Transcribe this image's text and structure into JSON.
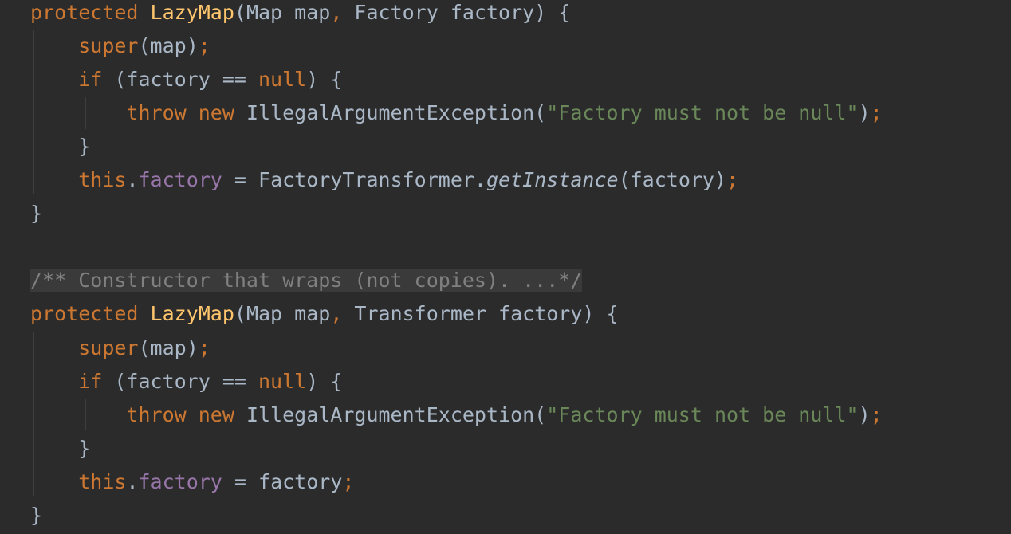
{
  "editor": {
    "theme": {
      "background": "#2b2b2b",
      "keyword": "#cc7832",
      "method": "#ffc66d",
      "identifier": "#a9b7c6",
      "string": "#6a8759",
      "field": "#9876aa",
      "comment": "#808080"
    },
    "lines": [
      [
        {
          "t": "protected",
          "c": "kw"
        },
        {
          "t": " ",
          "c": "id"
        },
        {
          "t": "LazyMap",
          "c": "fn"
        },
        {
          "t": "(Map map",
          "c": "id"
        },
        {
          "t": ",",
          "c": "kw"
        },
        {
          "t": " Factory factory) {",
          "c": "id"
        }
      ],
      [
        {
          "t": "    ",
          "c": "id"
        },
        {
          "t": "super",
          "c": "kw"
        },
        {
          "t": "(map)",
          "c": "id"
        },
        {
          "t": ";",
          "c": "kw"
        }
      ],
      [
        {
          "t": "    ",
          "c": "id"
        },
        {
          "t": "if",
          "c": "kw"
        },
        {
          "t": " (factory == ",
          "c": "id"
        },
        {
          "t": "null",
          "c": "kw"
        },
        {
          "t": ") {",
          "c": "id"
        }
      ],
      [
        {
          "t": "        ",
          "c": "id"
        },
        {
          "t": "throw new",
          "c": "kw"
        },
        {
          "t": " IllegalArgumentException(",
          "c": "id"
        },
        {
          "t": "\"Factory must not be null\"",
          "c": "str"
        },
        {
          "t": ")",
          "c": "id"
        },
        {
          "t": ";",
          "c": "kw"
        }
      ],
      [
        {
          "t": "    }",
          "c": "id"
        }
      ],
      [
        {
          "t": "    ",
          "c": "id"
        },
        {
          "t": "this",
          "c": "kw"
        },
        {
          "t": ".",
          "c": "id"
        },
        {
          "t": "factory",
          "c": "fld"
        },
        {
          "t": " = FactoryTransformer.",
          "c": "id"
        },
        {
          "t": "getInstance",
          "c": "id it"
        },
        {
          "t": "(factory)",
          "c": "id"
        },
        {
          "t": ";",
          "c": "kw"
        }
      ],
      [
        {
          "t": "}",
          "c": "id"
        }
      ],
      [],
      [
        {
          "t": "/** Constructor that wraps (not copies). ...*/",
          "c": "cm"
        }
      ],
      [
        {
          "t": "protected",
          "c": "kw"
        },
        {
          "t": " ",
          "c": "id"
        },
        {
          "t": "LazyMap",
          "c": "fn"
        },
        {
          "t": "(Map map",
          "c": "id"
        },
        {
          "t": ",",
          "c": "kw"
        },
        {
          "t": " Transformer factory) {",
          "c": "id"
        }
      ],
      [
        {
          "t": "    ",
          "c": "id"
        },
        {
          "t": "super",
          "c": "kw"
        },
        {
          "t": "(map)",
          "c": "id"
        },
        {
          "t": ";",
          "c": "kw"
        }
      ],
      [
        {
          "t": "    ",
          "c": "id"
        },
        {
          "t": "if",
          "c": "kw"
        },
        {
          "t": " (factory == ",
          "c": "id"
        },
        {
          "t": "null",
          "c": "kw"
        },
        {
          "t": ") {",
          "c": "id"
        }
      ],
      [
        {
          "t": "        ",
          "c": "id"
        },
        {
          "t": "throw new",
          "c": "kw"
        },
        {
          "t": " IllegalArgumentException(",
          "c": "id"
        },
        {
          "t": "\"Factory must not be null\"",
          "c": "str"
        },
        {
          "t": ")",
          "c": "id"
        },
        {
          "t": ";",
          "c": "kw"
        }
      ],
      [
        {
          "t": "    }",
          "c": "id"
        }
      ],
      [
        {
          "t": "    ",
          "c": "id"
        },
        {
          "t": "this",
          "c": "kw"
        },
        {
          "t": ".",
          "c": "id"
        },
        {
          "t": "factory",
          "c": "fld"
        },
        {
          "t": " = factory",
          "c": "id"
        },
        {
          "t": ";",
          "c": "kw"
        }
      ],
      [
        {
          "t": "}",
          "c": "id"
        }
      ]
    ]
  }
}
